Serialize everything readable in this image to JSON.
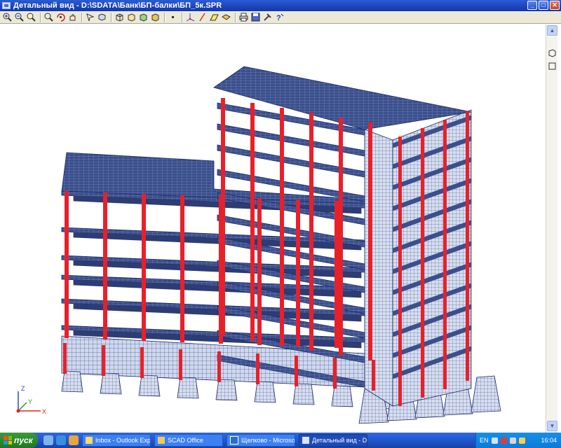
{
  "window": {
    "title": "Детальный вид - D:\\SDATA\\Банк\\БП-балки\\БП_5к.SPR",
    "minimize_label": "_",
    "maximize_label": "□",
    "close_label": "✕"
  },
  "toolbar": {
    "icons": [
      "zoom-in-icon",
      "zoom-out-icon",
      "zoom-window-icon",
      "zoom-all-icon",
      "rotate-icon",
      "pan-icon",
      "select-icon",
      "view-options-icon",
      "projection-icon",
      "cube-icon",
      "box-solid-icon",
      "box-shaded-icon",
      "nodes-icon",
      "axes-icon",
      "line-icon",
      "fill-icon",
      "print-icon",
      "save-icon",
      "fragment-icon",
      "help-icon"
    ]
  },
  "canvas": {
    "axes": {
      "z": "Z",
      "y": "Y",
      "x": "X"
    }
  },
  "taskbar": {
    "start_label": "пуск",
    "tasks": [
      {
        "label": "Inbox - Outlook Express",
        "active": false
      },
      {
        "label": "SCAD Office",
        "active": false
      },
      {
        "label": "Щелково - Microsoft ...",
        "active": false
      },
      {
        "label": "Детальный вид - D:...",
        "active": true
      }
    ],
    "language": "EN",
    "clock": "16:04"
  },
  "colors": {
    "slab": "#3b4f8c",
    "column": "#e8202a",
    "wall": "#cfd8ee",
    "mesh_line": "#1a2966"
  }
}
